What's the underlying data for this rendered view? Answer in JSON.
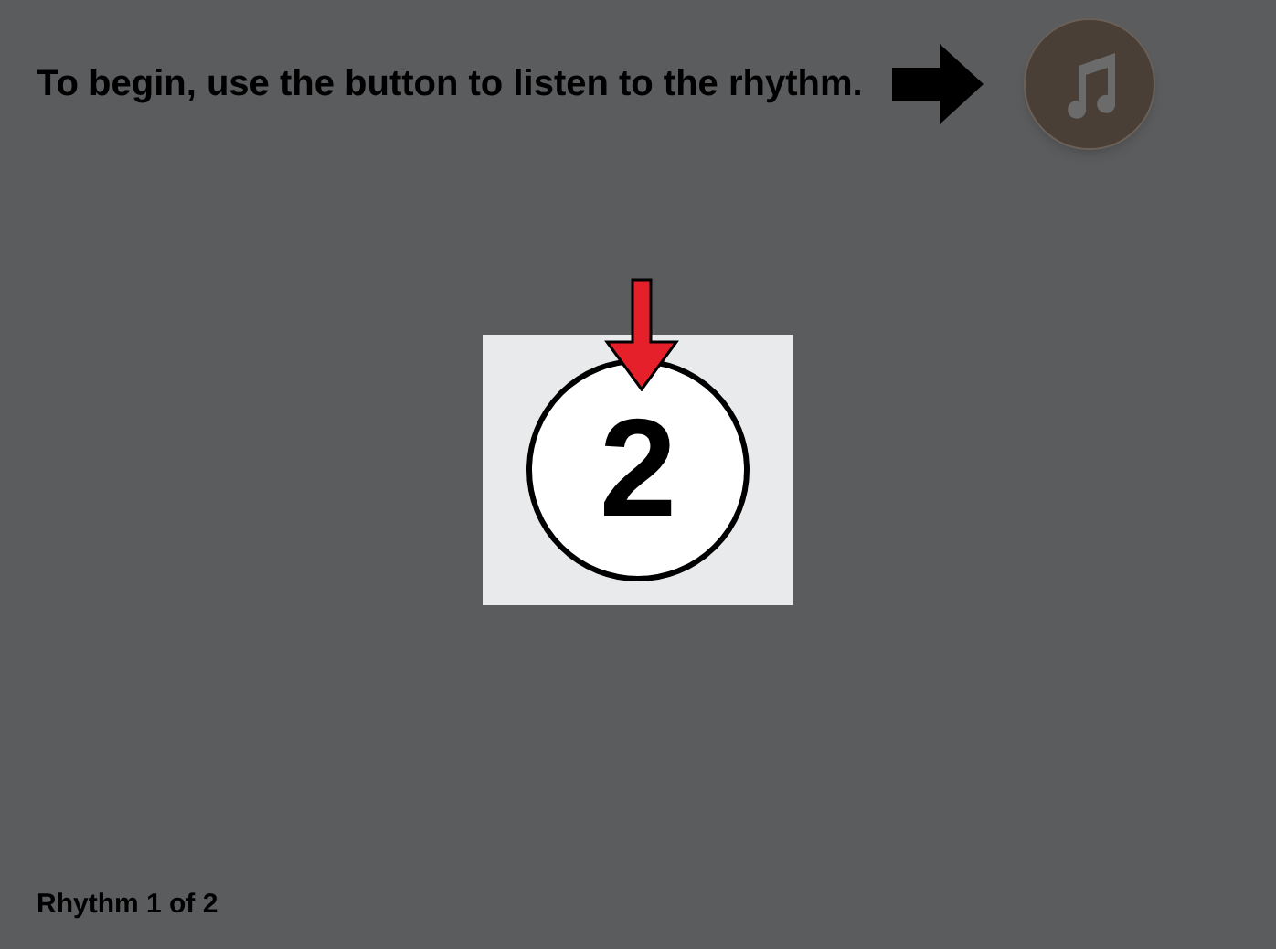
{
  "instruction": "To begin, use the button to listen to the rhythm.",
  "card": {
    "number": "2"
  },
  "footer": "Rhythm 1 of 2"
}
